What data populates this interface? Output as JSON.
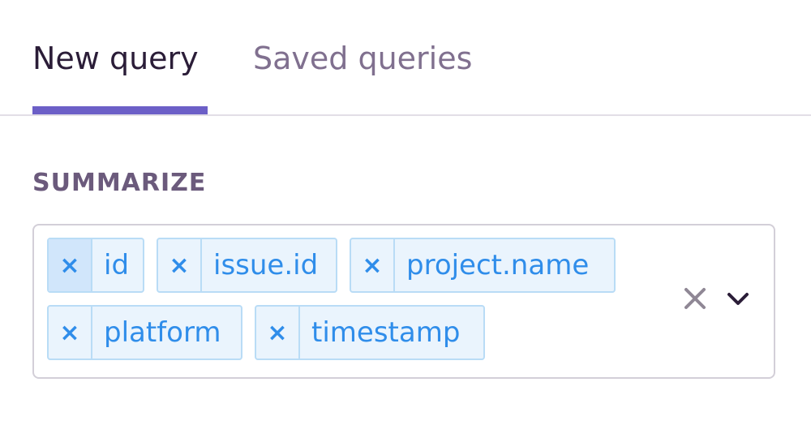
{
  "tabs": {
    "new_query": "New query",
    "saved_queries": "Saved queries",
    "active": "New query"
  },
  "summarize": {
    "label": "SUMMARIZE",
    "chips": [
      {
        "label": "id",
        "remove": "×"
      },
      {
        "label": "issue.id",
        "remove": "×"
      },
      {
        "label": "project.name",
        "remove": "×"
      },
      {
        "label": "platform",
        "remove": "×"
      },
      {
        "label": "timestamp",
        "remove": "×"
      }
    ],
    "clear_icon": "clear-icon",
    "dropdown_icon": "chevron-down-icon"
  },
  "colors": {
    "accent": "#6c5fc7",
    "chip_text": "#2f8dea",
    "chip_bg": "#eaf4fd",
    "chip_border": "#b9dcf6",
    "label": "#6b5a7c",
    "inactive_tab": "#80708f"
  }
}
